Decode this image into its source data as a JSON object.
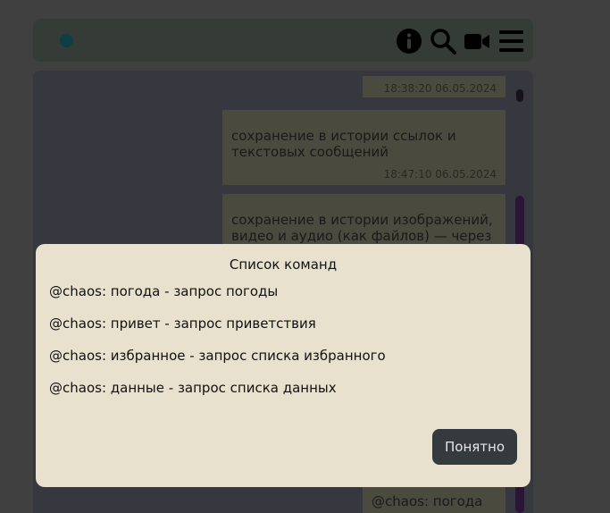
{
  "header": {
    "icons": [
      "info-icon",
      "search-icon",
      "video-camera-icon",
      "menu-icon"
    ]
  },
  "messages": [
    {
      "text": "",
      "time": "18:38:20 06.05.2024"
    },
    {
      "text": "сохранение в истории ссылок и текстовых сообщений",
      "time": "18:47:10 06.05.2024"
    },
    {
      "text": "сохранение в истории изображений, видео и аудио (как файлов) — через",
      "time": ""
    },
    {
      "text": "@chaos: погода",
      "time": ""
    }
  ],
  "modal": {
    "title": "Список команд",
    "commands": [
      "@chaos: погода - запрос погоды",
      "@chaos: привет - запрос приветствия",
      "@chaos: избранное - запрос списка избранного",
      "@chaos: данные - запрос списка данных"
    ],
    "ok_label": "Понятно"
  },
  "colors": {
    "background": "#404040",
    "header": "#353b36",
    "modal": "#e8e1cd",
    "button": "#343a3e",
    "status_dot": "#0d3f44",
    "scroll_thumb": "#2a1536"
  }
}
